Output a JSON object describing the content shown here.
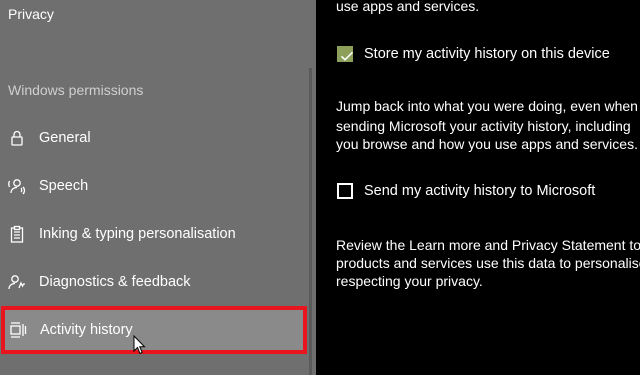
{
  "sidebar": {
    "title": "Privacy",
    "section": "Windows permissions",
    "items": [
      {
        "label": "General",
        "icon": "lock-icon"
      },
      {
        "label": "Speech",
        "icon": "speech-icon"
      },
      {
        "label": "Inking & typing personalisation",
        "icon": "clipboard-icon"
      },
      {
        "label": "Diagnostics & feedback",
        "icon": "diagnostics-icon"
      },
      {
        "label": "Activity history",
        "icon": "activity-history-icon",
        "selected": true
      }
    ]
  },
  "content": {
    "intro_tail": "use apps and services.",
    "store_checkbox": {
      "label": "Store my activity history on this device",
      "checked": true
    },
    "store_desc": [
      "Jump back into what you were doing, even when",
      "sending Microsoft your activity history, including",
      "you browse and how you use apps and services."
    ],
    "send_checkbox": {
      "label": "Send my activity history to Microsoft",
      "checked": false
    },
    "review_desc": [
      "Review the Learn more and Privacy Statement to f",
      "products and services use this data to personalise",
      "respecting your privacy."
    ]
  },
  "colors": {
    "sidebar_bg": "#6f6f6f",
    "selected_bg": "#8a8a8a",
    "highlight": "#e8141e",
    "checkbox_accent": "#8da05b"
  }
}
